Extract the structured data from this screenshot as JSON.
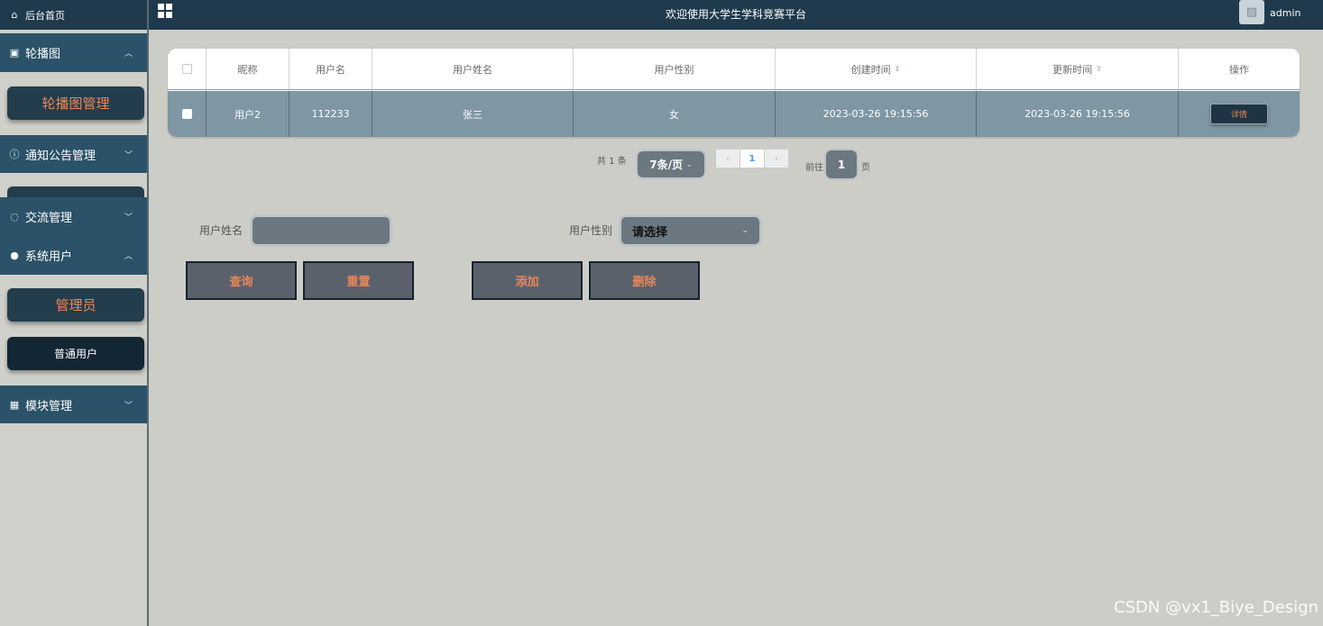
{
  "sidebar": {
    "home_label": "后台首页",
    "groups": [
      {
        "label": "轮播图",
        "chevron": "^",
        "items": [
          {
            "label": "轮播图管理"
          }
        ]
      },
      {
        "label": "通知公告管理",
        "chevron": "v"
      },
      {
        "label": "交流管理",
        "chevron": "v"
      },
      {
        "label": "系统用户",
        "chevron": "^",
        "items": [
          {
            "label": "管理员"
          },
          {
            "label": "普通用户"
          }
        ]
      },
      {
        "label": "模块管理",
        "chevron": "v"
      }
    ]
  },
  "header": {
    "title": "欢迎使用大学生学科竞赛平台",
    "username": "admin"
  },
  "table": {
    "columns": [
      "昵称",
      "用户名",
      "用户姓名",
      "用户性别",
      "创建时间",
      "更新时间",
      "操作"
    ],
    "rows": [
      {
        "nickname": "用户2",
        "username": "112233",
        "name": "张三",
        "gender": "女",
        "created": "2023-03-26 19:15:56",
        "updated": "2023-03-26 19:15:56",
        "action": "详情"
      }
    ]
  },
  "pagination": {
    "total": "共 1 条",
    "page_size": "7条/页",
    "prev": "‹",
    "current": "1",
    "next": "›",
    "goto_label": "前往",
    "goto_value": "1",
    "page_suffix": "页"
  },
  "search": {
    "name_label": "用户姓名",
    "name_value": "",
    "gender_label": "用户性别",
    "gender_value": "请选择"
  },
  "buttons": {
    "query": "查询",
    "reset": "重置",
    "add": "添加",
    "delete": "删除"
  },
  "watermark": "CSDN @vx1_Biye_Design",
  "colors": {
    "sidebar_dark": "#1e3a4c",
    "sidebar_group": "#2b5268",
    "accent_orange": "#e6885a",
    "row_bg": "#7f96a3"
  }
}
